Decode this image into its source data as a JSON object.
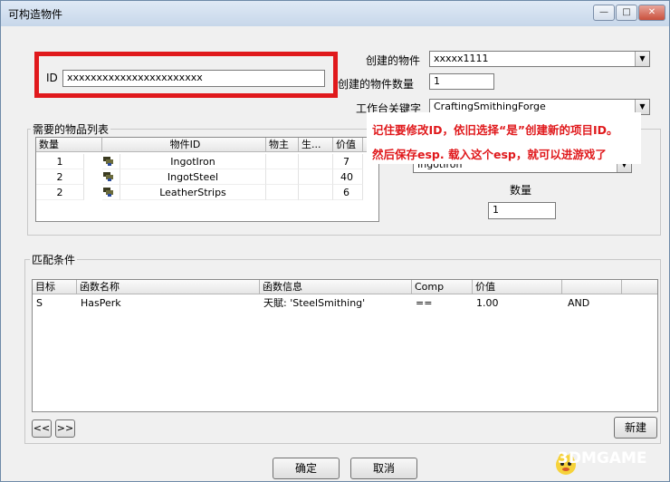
{
  "window": {
    "title": "可构造物件",
    "buttons": {
      "minimize": "—",
      "maximize": "□",
      "close": "✕"
    }
  },
  "form": {
    "id_label": "ID",
    "id_value": "xxxxxxxxxxxxxxxxxxxxxxx",
    "created_object_label": "创建的物件",
    "created_object_value": "xxxxx1111",
    "created_count_label": "创建的物件数量",
    "created_count_value": "1",
    "workbench_keyword_label": "工作台关键字",
    "workbench_keyword_value": "CraftingSmithingForge"
  },
  "required_items": {
    "group_title": "需要的物品列表",
    "columns": [
      "数量",
      "物件ID",
      "物主",
      "生...",
      "价值"
    ],
    "rows": [
      {
        "qty": "1",
        "id": "IngotIron",
        "owner": "",
        "life": "",
        "value": "7"
      },
      {
        "qty": "2",
        "id": "IngotSteel",
        "owner": "",
        "life": "",
        "value": "40"
      },
      {
        "qty": "2",
        "id": "LeatherStrips",
        "owner": "",
        "life": "",
        "value": "6"
      }
    ],
    "item_combo_value": "IngotIron",
    "count_label": "数量",
    "count_value": "1"
  },
  "conditions": {
    "group_title": "匹配条件",
    "columns": [
      "目标",
      "函数名称",
      "函数信息",
      "Comp",
      "价值",
      ""
    ],
    "rows": [
      {
        "target": "S",
        "function": "HasPerk",
        "info": "天賦: 'SteelSmithing'",
        "comp": "==",
        "value": "1.00",
        "logic": "AND"
      }
    ],
    "prev_button": "<<",
    "next_button": ">>",
    "new_button": "新建"
  },
  "footer": {
    "ok_button": "确定",
    "cancel_button": "取消"
  },
  "annotation": {
    "line1": "记住要修改ID，依旧选择“是”创建新的项目ID。",
    "line2": "然后保存esp. 载入这个esp，就可以进游戏了"
  },
  "watermark": {
    "text": "3DMGAME"
  },
  "colors": {
    "annotation_red": "#e0191c",
    "window_bg": "#f0f0f0"
  }
}
